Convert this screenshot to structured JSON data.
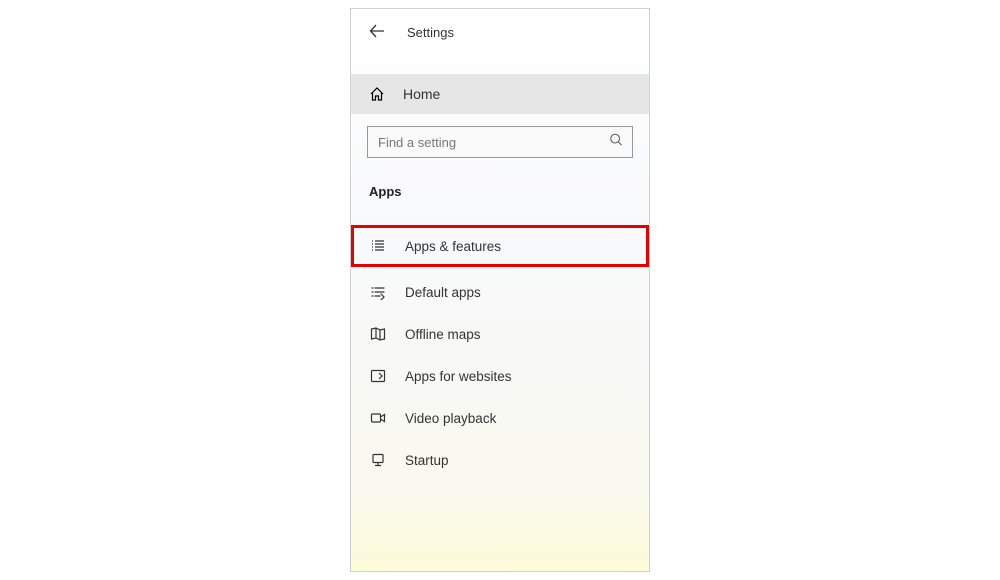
{
  "header": {
    "title": "Settings"
  },
  "home": {
    "label": "Home"
  },
  "search": {
    "placeholder": "Find a setting"
  },
  "section": {
    "title": "Apps"
  },
  "nav": {
    "items": [
      {
        "label": "Apps & features",
        "highlighted": true
      },
      {
        "label": "Default apps",
        "highlighted": false
      },
      {
        "label": "Offline maps",
        "highlighted": false
      },
      {
        "label": "Apps for websites",
        "highlighted": false
      },
      {
        "label": "Video playback",
        "highlighted": false
      },
      {
        "label": "Startup",
        "highlighted": false
      }
    ]
  }
}
